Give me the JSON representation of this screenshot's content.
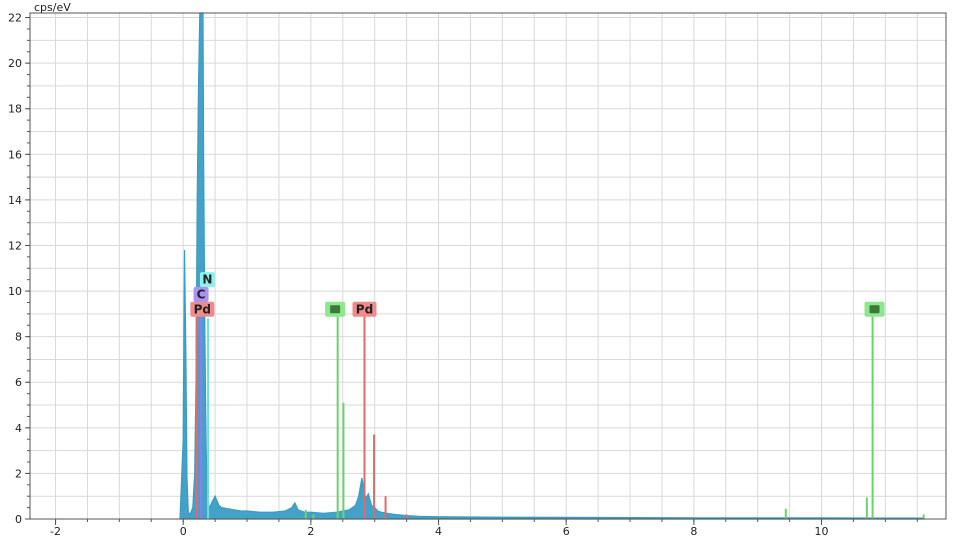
{
  "chart_data": {
    "type": "line",
    "title": "",
    "xlabel": "",
    "ylabel": "cps/eV",
    "xlim": [
      -2.4,
      11.95
    ],
    "ylim": [
      0,
      22.2
    ],
    "x_ticks": [
      -2,
      0,
      2,
      4,
      6,
      8,
      10
    ],
    "y_ticks": [
      0,
      2,
      4,
      6,
      8,
      10,
      12,
      14,
      16,
      18,
      20,
      22
    ],
    "grid": true,
    "legend": "none",
    "series": [
      {
        "color": "#3a9cc4",
        "x": [
          -0.05,
          0.0,
          0.02,
          0.04,
          0.06,
          0.08,
          0.1,
          0.12,
          0.15,
          0.18,
          0.2,
          0.22,
          0.24,
          0.26,
          0.27,
          0.28,
          0.3,
          0.31,
          0.32,
          0.34,
          0.36,
          0.38,
          0.4,
          0.43,
          0.46,
          0.5,
          0.53,
          0.56,
          0.6,
          0.7,
          0.8,
          0.9,
          1.0,
          1.2,
          1.4,
          1.6,
          1.7,
          1.75,
          1.8,
          1.9,
          2.0,
          2.2,
          2.4,
          2.6,
          2.7,
          2.75,
          2.8,
          2.83,
          2.86,
          2.9,
          2.95,
          3.0,
          3.05,
          3.1,
          3.2,
          3.3,
          3.5,
          3.7,
          4.0,
          5.0,
          6.0,
          7.0,
          8.0,
          9.0,
          10.0,
          11.0,
          11.6
        ],
        "y": [
          0.0,
          3.5,
          11.8,
          7.5,
          1.8,
          0.3,
          0.2,
          0.3,
          0.5,
          2.0,
          6.0,
          14.0,
          19.0,
          22.2,
          22.2,
          22.2,
          22.2,
          22.2,
          16.0,
          8.0,
          3.0,
          1.5,
          0.5,
          0.6,
          0.8,
          1.0,
          0.8,
          0.6,
          0.5,
          0.45,
          0.4,
          0.35,
          0.35,
          0.3,
          0.3,
          0.35,
          0.5,
          0.7,
          0.4,
          0.3,
          0.3,
          0.25,
          0.3,
          0.4,
          0.6,
          1.0,
          1.8,
          1.3,
          0.9,
          1.1,
          0.6,
          0.5,
          0.35,
          0.3,
          0.25,
          0.2,
          0.15,
          0.12,
          0.1,
          0.08,
          0.07,
          0.06,
          0.05,
          0.05,
          0.05,
          0.04,
          0.04
        ]
      }
    ],
    "element_lines": [
      {
        "x": 0.21,
        "height": 9.0,
        "color": "#e26a6a"
      },
      {
        "x": 0.28,
        "height": 9.9,
        "color": "#8d7cf0"
      },
      {
        "x": 0.39,
        "height": 8.8,
        "color": "#6fdde0"
      },
      {
        "x": 2.42,
        "height": 8.9,
        "color": "#6ad36a"
      },
      {
        "x": 2.51,
        "height": 5.1,
        "color": "#6ad36a"
      },
      {
        "x": 2.84,
        "height": 8.9,
        "color": "#e26a6a"
      },
      {
        "x": 2.99,
        "height": 3.7,
        "color": "#e26a6a"
      },
      {
        "x": 3.17,
        "height": 1.0,
        "color": "#e26a6a"
      },
      {
        "x": 3.5,
        "height": 0.2,
        "color": "#e26a6a"
      },
      {
        "x": 1.92,
        "height": 0.4,
        "color": "#6ad36a"
      },
      {
        "x": 2.04,
        "height": 0.2,
        "color": "#6ad36a"
      },
      {
        "x": 9.44,
        "height": 0.45,
        "color": "#6ad36a"
      },
      {
        "x": 10.71,
        "height": 0.95,
        "color": "#6ad36a"
      },
      {
        "x": 10.8,
        "height": 8.9,
        "color": "#6ad36a"
      },
      {
        "x": 11.6,
        "height": 0.2,
        "color": "#6ad36a"
      }
    ],
    "element_markers": [
      {
        "text": "N",
        "x": 0.38,
        "y": 10.5,
        "color": "#8ff0f0"
      },
      {
        "text": "C",
        "x": 0.28,
        "y": 9.85,
        "color": "#a994f5"
      },
      {
        "text": "Pd",
        "x": 0.3,
        "y": 9.2,
        "color": "#f08b8b"
      },
      {
        "text": "",
        "x": 2.38,
        "y": 9.2,
        "color": "#8ee68e"
      },
      {
        "text": "Pd",
        "x": 2.84,
        "y": 9.2,
        "color": "#f08b8b"
      },
      {
        "text": "",
        "x": 10.83,
        "y": 9.2,
        "color": "#8ee68e"
      }
    ],
    "colors": {
      "background": "#ffffff",
      "grid": "#d9d9d9",
      "axis": "#555555",
      "spectrum": "#3a9cc4"
    }
  }
}
